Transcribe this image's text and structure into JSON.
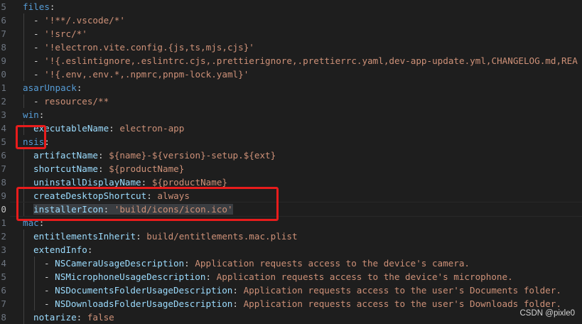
{
  "gutter_numbers": [
    "5",
    "6",
    "7",
    "8",
    "9",
    "0",
    "1",
    "2",
    "3",
    "4",
    "5",
    "6",
    "7",
    "8",
    "9",
    "0",
    "1",
    "2",
    "3",
    "4",
    "5",
    "6",
    "7",
    "8"
  ],
  "active_line_number": "0",
  "code": {
    "files_key": "files",
    "files_items": [
      "'!**/.vscode/*'",
      "'!src/*'",
      "'!electron.vite.config.{js,ts,mjs,cjs}'",
      "'!{.eslintignore,.eslintrc.cjs,.prettierignore,.prettierrc.yaml,dev-app-update.yml,CHANGELOG.md,REA",
      "'!{.env,.env.*,.npmrc,pnpm-lock.yaml}'"
    ],
    "asarUnpack_key": "asarUnpack",
    "asarUnpack_item": "resources/**",
    "win_key": "win",
    "executableName_key": "executableName",
    "executableName_val": "electron-app",
    "nsis_key": "nsis",
    "artifactName_key": "artifactName",
    "artifactName_val": "${name}-${version}-setup.${ext}",
    "shortcutName_key": "shortcutName",
    "shortcutName_val": "${productName}",
    "uninstallDisplayName_key": "uninstallDisplayName",
    "uninstallDisplayName_val": "${productName}",
    "createDesktopShortcut_key": "createDesktopShortcut",
    "createDesktopShortcut_val": "always",
    "installerIcon_key": "installerIcon",
    "installerIcon_val": "'build/icons/icon.ico'",
    "mac_key": "mac",
    "entitlementsInherit_key": "entitlementsInherit",
    "entitlementsInherit_val": "build/entitlements.mac.plist",
    "extendInfo_key": "extendInfo",
    "camera_key": "NSCameraUsageDescription",
    "camera_val": "Application requests access to the device's camera.",
    "mic_key": "NSMicrophoneUsageDescription",
    "mic_val": "Application requests access to the device's microphone.",
    "docs_key": "NSDocumentsFolderUsageDescription",
    "docs_val": "Application requests access to the user's Documents folder.",
    "downloads_key": "NSDownloadsFolderUsageDescription",
    "downloads_val": "Application requests access to the user's Downloads folder.",
    "notarize_key": "notarize",
    "notarize_val": "false"
  },
  "watermark": "CSDN @pixle0",
  "colors": {
    "background": "#1e1e1e",
    "key": "#569cd6",
    "nested_key": "#9cdcfe",
    "string": "#ce9178",
    "annotation_box": "#e81c1c"
  }
}
